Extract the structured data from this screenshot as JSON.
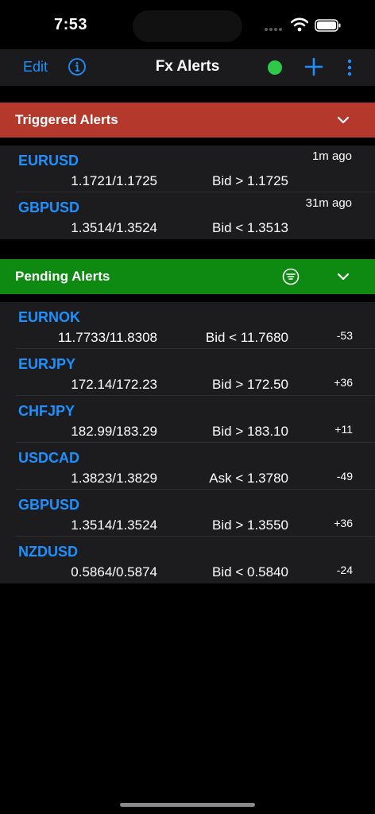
{
  "status_bar": {
    "time": "7:53"
  },
  "nav": {
    "edit_label": "Edit",
    "title": "Fx Alerts",
    "connection_color": "#2fc94a"
  },
  "triggered": {
    "title": "Triggered Alerts",
    "color": "#b5382c",
    "items": [
      {
        "pair": "EURUSD",
        "price": "1.1721/1.1725",
        "condition": "Bid > 1.1725",
        "time": "1m ago"
      },
      {
        "pair": "GBPUSD",
        "price": "1.3514/1.3524",
        "condition": "Bid < 1.3513",
        "time": "31m ago"
      }
    ]
  },
  "pending": {
    "title": "Pending Alerts",
    "color": "#0e8a12",
    "items": [
      {
        "pair": "EURNOK",
        "price": "11.7733/11.8308",
        "condition": "Bid < 11.7680",
        "delta": "-53"
      },
      {
        "pair": "EURJPY",
        "price": "172.14/172.23",
        "condition": "Bid > 172.50",
        "delta": "+36"
      },
      {
        "pair": "CHFJPY",
        "price": "182.99/183.29",
        "condition": "Bid > 183.10",
        "delta": "+11"
      },
      {
        "pair": "USDCAD",
        "price": "1.3823/1.3829",
        "condition": "Ask < 1.3780",
        "delta": "-49"
      },
      {
        "pair": "GBPUSD",
        "price": "1.3514/1.3524",
        "condition": "Bid > 1.3550",
        "delta": "+36"
      },
      {
        "pair": "NZDUSD",
        "price": "0.5864/0.5874",
        "condition": "Bid < 0.5840",
        "delta": "-24"
      }
    ]
  }
}
